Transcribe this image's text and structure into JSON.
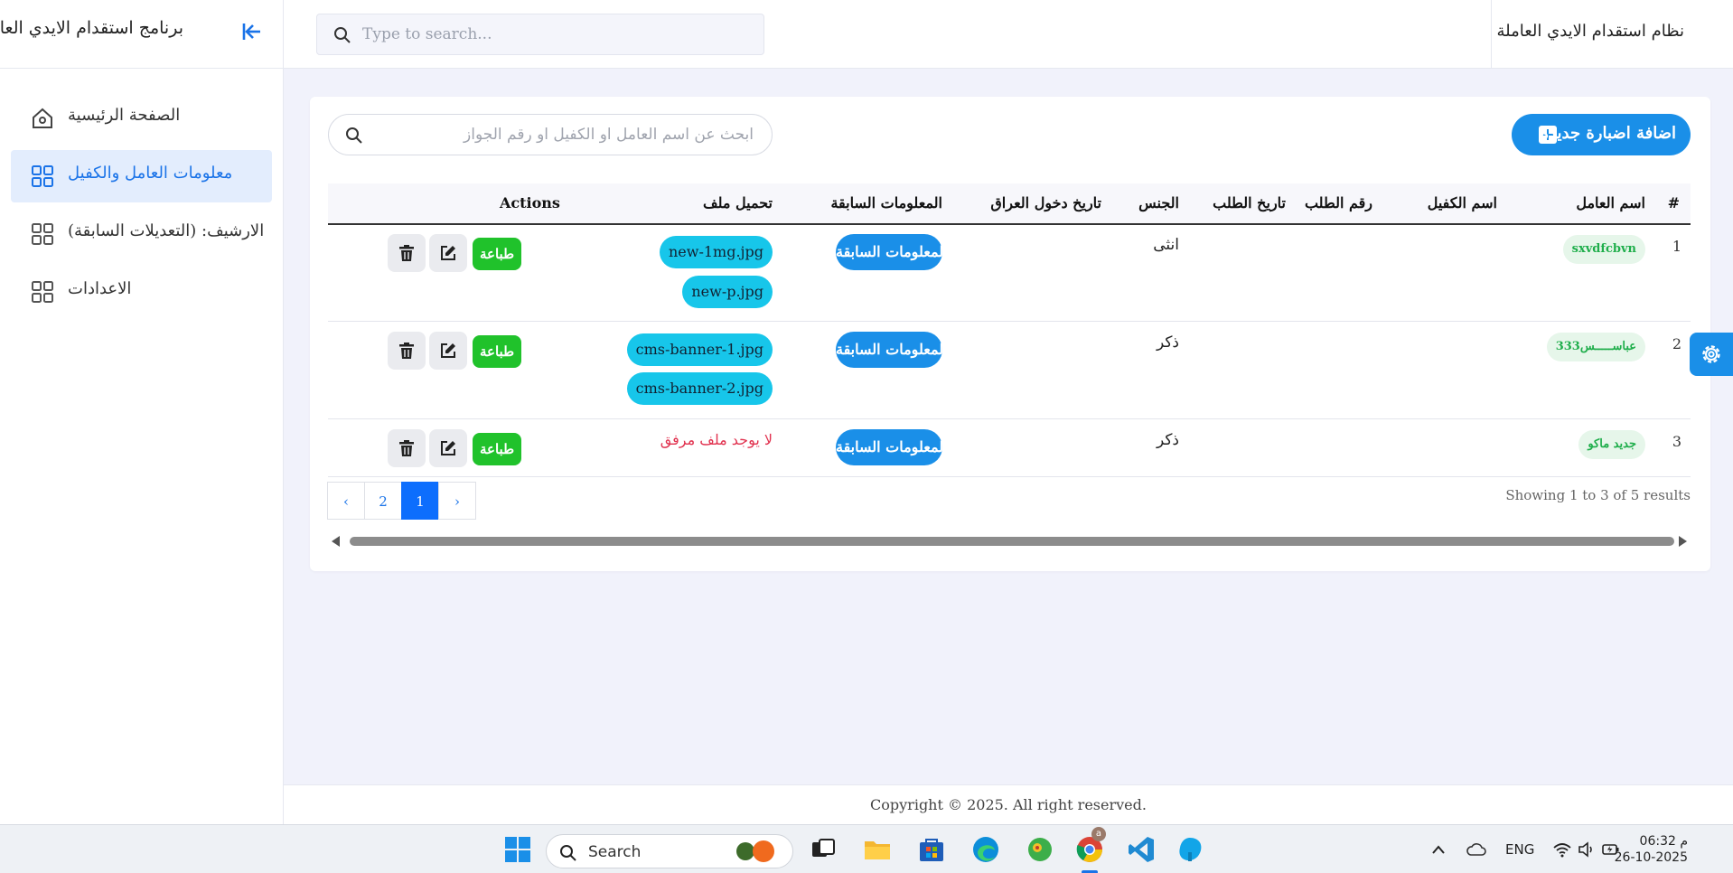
{
  "sidebar": {
    "app_title": "برنامج استقدام الايدي العاملة",
    "items": [
      {
        "label": "الصفحة الرئيسية",
        "icon": "home-icon",
        "active": false
      },
      {
        "label": "معلومات العامل والكفيل",
        "icon": "grid-icon",
        "active": true
      },
      {
        "label": "الارشيف: (التعديلات السابقة)",
        "icon": "grid-icon",
        "active": false
      },
      {
        "label": "الاعدادات",
        "icon": "grid-icon",
        "active": false
      }
    ]
  },
  "topbar": {
    "search_placeholder": "Type to search...",
    "system_title": "نظام استقدام الايدي العاملة"
  },
  "card": {
    "add_button_label": "اضافة اضبارة جديدة",
    "search_placeholder": "ابحث عن اسم العامل او الكفيل او رقم الجواز",
    "columns": {
      "index": "#",
      "worker_name": "اسم العامل",
      "sponsor_name": "اسم الكفيل",
      "request_number": "رقم الطلب",
      "request_date": "تاريخ الطلب",
      "gender": "الجنس",
      "iraq_entry_date": "تاريخ دخول العراق",
      "previous_info": "المعلومات السابقة",
      "file_upload": "تحميل ملف",
      "actions": "Actions"
    },
    "rows": [
      {
        "index": "1",
        "worker_name": "sxvdfcbvn",
        "gender": "انثى",
        "previous_info_label": "المعلومات السابقة",
        "files": [
          "new-1mg.jpg",
          "new-p.jpg"
        ],
        "print_label": "طباعة"
      },
      {
        "index": "2",
        "worker_name": "عباســـــس333",
        "gender": "ذكر",
        "previous_info_label": "المعلومات السابقة",
        "files": [
          "cms-banner-1.jpg",
          "cms-banner-2.jpg"
        ],
        "print_label": "طباعة"
      },
      {
        "index": "3",
        "worker_name": "جديد ماكو",
        "gender": "ذكر",
        "previous_info_label": "المعلومات السابقة",
        "no_file_text": "لا يوجد ملف مرفق",
        "print_label": "طباعة"
      }
    ],
    "pagination": {
      "prev": "‹",
      "pages": [
        "2",
        "1"
      ],
      "active_page": "1",
      "next": "›"
    },
    "showing_text": "Showing 1 to 3 of 5 results"
  },
  "footer": {
    "copyright": "Copyright © 2025. All right reserved."
  },
  "taskbar": {
    "search_label": "Search",
    "language": "ENG",
    "time": "06:32 م",
    "date": "26-10-2025",
    "chrome_badge": "a",
    "apps": [
      "start-icon",
      "search",
      "task-view-icon",
      "file-explorer-icon",
      "store-icon",
      "edge-icon",
      "chameleon-app-icon",
      "chrome-icon",
      "vscode-icon",
      "blue-app-icon"
    ]
  },
  "colors": {
    "primary": "#1a8fe8",
    "print_green": "#20c22b",
    "file_cyan": "#17c6ea",
    "no_file_red": "#e1324f",
    "name_badge_bg": "#e6f6ea",
    "name_badge_text": "#1fae4b"
  }
}
